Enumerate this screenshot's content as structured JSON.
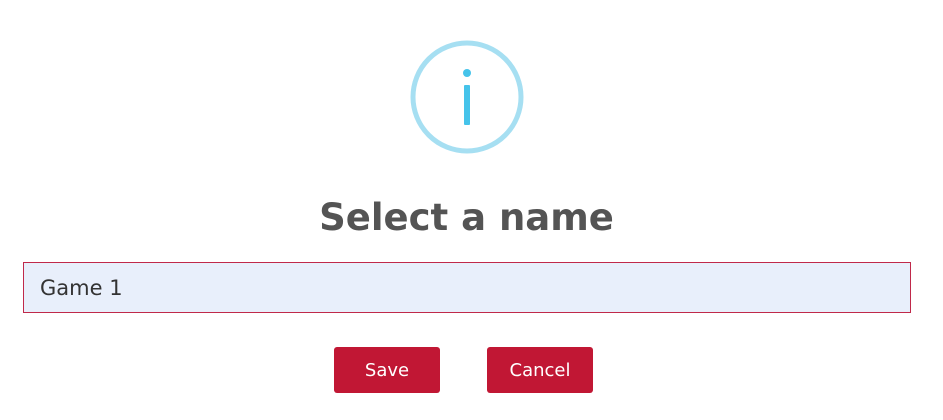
{
  "dialog": {
    "icon": "info-icon",
    "title": "Select a name",
    "name_value": "Game 1",
    "save_label": "Save",
    "cancel_label": "Cancel"
  },
  "colors": {
    "icon_ring": "#a6dff2",
    "icon_glyph": "#45c3ea",
    "title": "#545454",
    "input_border": "#c0294a",
    "input_background": "#e8effb",
    "button_background": "#c11734",
    "button_text": "#ffffff"
  }
}
